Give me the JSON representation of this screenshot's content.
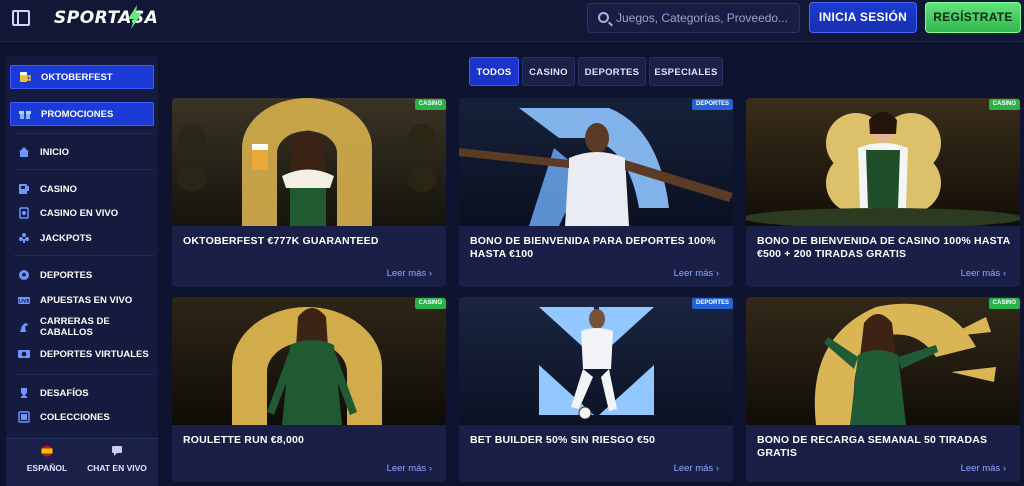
{
  "header": {
    "logo": "SPORTASA",
    "search_placeholder": "Juegos, Categorías, Proveedo...",
    "login_label": "INICIA SESIÓN",
    "register_label": "REGÍSTRATE"
  },
  "sidebar": {
    "items": [
      {
        "label": "OKTOBERFEST",
        "icon": "beer-icon"
      },
      {
        "label": "PROMOCIONES",
        "icon": "gift-icon"
      },
      {
        "label": "INICIO",
        "icon": "home-icon"
      },
      {
        "label": "CASINO",
        "icon": "slot-icon"
      },
      {
        "label": "CASINO EN VIVO",
        "icon": "live-casino-icon"
      },
      {
        "label": "JACKPOTS",
        "icon": "jackpot-icon"
      },
      {
        "label": "DEPORTES",
        "icon": "soccer-ball-icon"
      },
      {
        "label": "APUESTAS EN VIVO",
        "icon": "live-bets-icon"
      },
      {
        "label": "CARRERAS DE CABALLOS",
        "icon": "horse-icon"
      },
      {
        "label": "DEPORTES VIRTUALES",
        "icon": "virtual-sports-icon"
      },
      {
        "label": "DESAFÍOS",
        "icon": "trophy-icon"
      },
      {
        "label": "COLECCIONES",
        "icon": "collections-icon"
      }
    ],
    "bottom": {
      "language_label": "ESPAÑOL",
      "chat_label": "CHAT EN VIVO"
    }
  },
  "tabs": [
    "TODOS",
    "CASINO",
    "DEPORTES",
    "ESPECIALES"
  ],
  "cards": [
    {
      "badge": "CASINO",
      "title": "OKTOBERFEST €777K GUARANTEED",
      "more": "Leer más"
    },
    {
      "badge": "DEPORTES",
      "title": "BONO DE BIENVENIDA PARA DEPORTES 100% HASTA €100",
      "more": "Leer más"
    },
    {
      "badge": "CASINO",
      "title": "BONO DE BIENVENIDA DE CASINO 100% HASTA €500 + 200 TIRADAS GRATIS",
      "more": "Leer más"
    },
    {
      "badge": "CASINO",
      "title": "ROULETTE RUN €8,000",
      "more": "Leer más"
    },
    {
      "badge": "DEPORTES",
      "title": "BET BUILDER 50% SIN RIESGO €50",
      "more": "Leer más"
    },
    {
      "badge": "CASINO",
      "title": "BONO DE RECARGA SEMANAL 50 TIRADAS GRATIS",
      "more": "Leer más"
    }
  ],
  "colors": {
    "accent": "#1a3bd6",
    "register": "#3fcf5e",
    "casino_badge": "#29b24a",
    "deportes_badge": "#2463d6"
  }
}
